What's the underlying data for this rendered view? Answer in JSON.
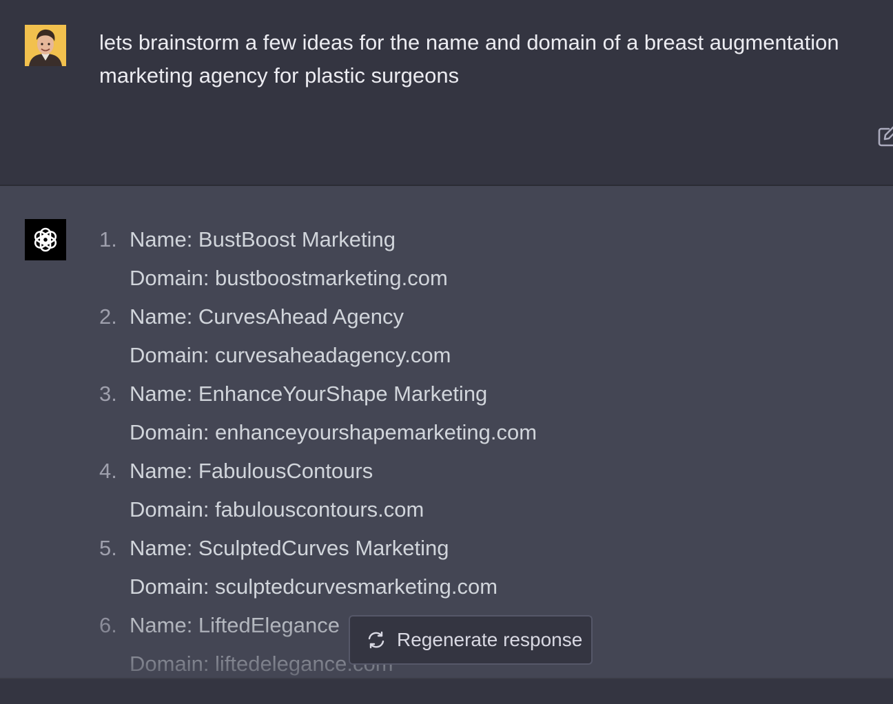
{
  "user_message": {
    "avatar": "user-avatar-photo",
    "text": "lets brainstorm a few ideas for the name and domain of a breast augmentation marketing agency for plastic surgeons",
    "edit_icon": "edit-icon"
  },
  "assistant_message": {
    "avatar": "openai-logo-icon",
    "items": [
      {
        "num": "1.",
        "name": "Name: BustBoost Marketing",
        "domain": "Domain: bustboostmarketing.com"
      },
      {
        "num": "2.",
        "name": "Name: CurvesAhead Agency",
        "domain": "Domain: curvesaheadagency.com"
      },
      {
        "num": "3.",
        "name": "Name: EnhanceYourShape Marketing",
        "domain": "Domain: enhanceyourshapemarketing.com"
      },
      {
        "num": "4.",
        "name": "Name: FabulousContours",
        "domain": "Domain: fabulouscontours.com"
      },
      {
        "num": "5.",
        "name": "Name: SculptedCurves Marketing",
        "domain": "Domain: sculptedcurvesmarketing.com"
      },
      {
        "num": "6.",
        "name": "Name: LiftedElegance",
        "domain": "Domain: liftedelegance.com"
      }
    ]
  },
  "regenerate": {
    "label": "Regenerate response",
    "icon": "refresh-icon"
  },
  "colors": {
    "user_bg": "#343541",
    "assistant_bg": "#444654",
    "text": "#d1d5db",
    "logo_bg": "#000000"
  }
}
